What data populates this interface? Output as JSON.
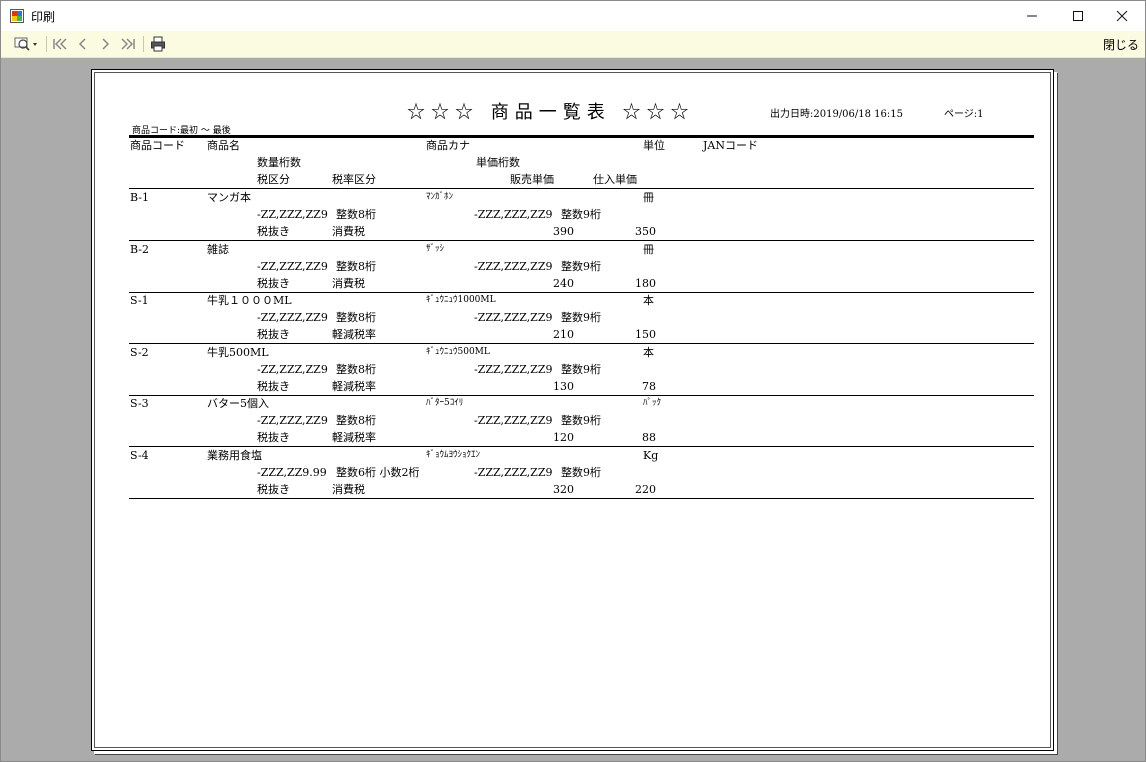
{
  "window": {
    "title": "印刷",
    "minimize_icon": "minimize-icon",
    "maximize_icon": "maximize-icon",
    "close_icon": "close-icon"
  },
  "toolbar": {
    "close_label": "閉じる",
    "icons": [
      "zoom-icon",
      "first-page-icon",
      "previous-page-icon",
      "next-page-icon",
      "last-page-icon",
      "print-icon"
    ]
  },
  "report": {
    "title": "☆☆☆ 商品一覧表 ☆☆☆",
    "output_date": "出力日時:2019/06/18 16:15",
    "page": "ページ:1",
    "range": "商品コード:最初 ～ 最後",
    "headers": {
      "code": "商品コード",
      "name": "商品名",
      "kana": "商品カナ",
      "unit": "単位",
      "jan": "JANコード",
      "qty_digits": "数量桁数",
      "price_digits": "単価桁数",
      "tax_type": "税区分",
      "tax_rate_type": "税率区分",
      "sale_price": "販売単価",
      "cost_price": "仕入単価"
    },
    "rows": [
      {
        "code": "B-1",
        "name": "マンガ本",
        "kana": "ﾏﾝｶﾞﾎﾝ",
        "unit": "冊",
        "qty_fmt": "-ZZ,ZZZ,ZZ9",
        "qty_desc": "整数8桁",
        "price_fmt": "-ZZZ,ZZZ,ZZ9",
        "price_desc": "整数9桁",
        "tax": "税抜き",
        "rate": "消費税",
        "sale": "390",
        "cost": "350"
      },
      {
        "code": "B-2",
        "name": "雑誌",
        "kana": "ｻﾞｯｼ",
        "unit": "冊",
        "qty_fmt": "-ZZ,ZZZ,ZZ9",
        "qty_desc": "整数8桁",
        "price_fmt": "-ZZZ,ZZZ,ZZ9",
        "price_desc": "整数9桁",
        "tax": "税抜き",
        "rate": "消費税",
        "sale": "240",
        "cost": "180"
      },
      {
        "code": "S-1",
        "name": "牛乳１０００ML",
        "kana": "ｷﾞｭｳﾆｭｳ1000ML",
        "unit": "本",
        "qty_fmt": "-ZZ,ZZZ,ZZ9",
        "qty_desc": "整数8桁",
        "price_fmt": "-ZZZ,ZZZ,ZZ9",
        "price_desc": "整数9桁",
        "tax": "税抜き",
        "rate": "軽減税率",
        "sale": "210",
        "cost": "150"
      },
      {
        "code": "S-2",
        "name": "牛乳500ML",
        "kana": "ｷﾞｭｳﾆｭｳ500ML",
        "unit": "本",
        "qty_fmt": "-ZZ,ZZZ,ZZ9",
        "qty_desc": "整数8桁",
        "price_fmt": "-ZZZ,ZZZ,ZZ9",
        "price_desc": "整数9桁",
        "tax": "税抜き",
        "rate": "軽減税率",
        "sale": "130",
        "cost": "78"
      },
      {
        "code": "S-3",
        "name": "バター5個入",
        "kana": "ﾊﾞﾀｰ5ｺｲﾘ",
        "unit": "ﾊﾟｯｸ",
        "qty_fmt": "-ZZ,ZZZ,ZZ9",
        "qty_desc": "整数8桁",
        "price_fmt": "-ZZZ,ZZZ,ZZ9",
        "price_desc": "整数9桁",
        "tax": "税抜き",
        "rate": "軽減税率",
        "sale": "120",
        "cost": "88"
      },
      {
        "code": "S-4",
        "name": "業務用食塩",
        "kana": "ｷﾞｮｳﾑﾖｳｼｮｸｴﾝ",
        "unit": "Kg",
        "qty_fmt": "-ZZZ,ZZ9.99",
        "qty_desc": "整数6桁 小数2桁",
        "price_fmt": "-ZZZ,ZZZ,ZZ9",
        "price_desc": "整数9桁",
        "tax": "税抜き",
        "rate": "消費税",
        "sale": "320",
        "cost": "220"
      }
    ]
  }
}
